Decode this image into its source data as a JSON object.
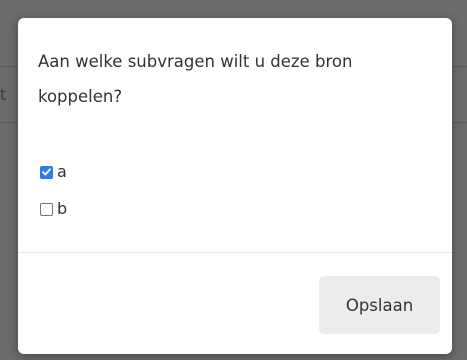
{
  "dialog": {
    "question": "Aan welke subvragen wilt u deze bron koppelen?",
    "options": [
      {
        "label": "a",
        "checked": true
      },
      {
        "label": "b",
        "checked": false
      }
    ],
    "save_label": "Opslaan"
  },
  "background": {
    "partial_glyph": "t"
  },
  "colors": {
    "accent": "#2f7de1",
    "overlay": "#6b6b6b",
    "button_bg": "#ececec"
  }
}
